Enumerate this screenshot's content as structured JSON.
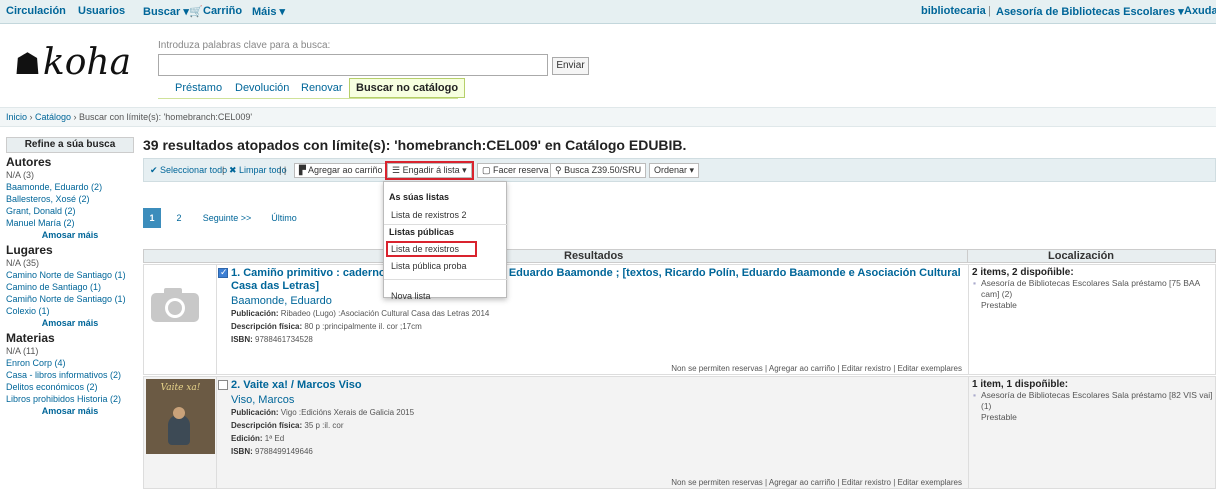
{
  "nav": {
    "circulacion": "Circulación",
    "usuarios": "Usuarios",
    "buscar": "Buscar ▾",
    "carrinho": "Carriño",
    "mais": "Máis ▾",
    "user": "bibliotecaria",
    "library": "Asesoría de Bibliotecas Escolares ▾",
    "axuda": "Axuda"
  },
  "logo": "koha",
  "search": {
    "hint": "Introduza palabras clave para a busca:",
    "value": "",
    "submit": "Enviar",
    "tabs": [
      "Préstamo",
      "Devolución",
      "Renovar",
      "Buscar no catálogo"
    ]
  },
  "breadcrumb": {
    "inicio": "Inicio",
    "catalogo": "Catálogo",
    "buscar": "Buscar",
    "rest": "con límite(s): 'homebranch:CEL009'"
  },
  "sidebar": {
    "refine": "Refine a súa busca",
    "autores": {
      "title": "Autores",
      "items": [
        "N/A (3)",
        "Baamonde, Eduardo (2)",
        "Ballesteros, Xosé (2)",
        "Grant, Donald (2)",
        "Manuel María (2)"
      ],
      "more": "Amosar máis"
    },
    "lugares": {
      "title": "Lugares",
      "items": [
        "N/A (35)",
        "Camino Norte de Santiago (1)",
        "Camino de Santiago (1)",
        "Camiño Norte de Santiago (1)",
        "Colexio (1)"
      ],
      "more": "Amosar máis"
    },
    "materias": {
      "title": "Materias",
      "items": [
        "N/A (11)",
        "Enron Corp (4)",
        "Casa - libros informativos (2)",
        "Delitos económicos (2)",
        "Libros prohibidos Historia (2)"
      ],
      "more": "Amosar máis"
    }
  },
  "results": {
    "heading": "39 resultados atopados  con límite(s): 'homebranch:CEL009' en Catálogo EDUBIB.",
    "toolbar": {
      "select_all": "✔ Seleccionar todo",
      "clear_all": "✖ Limpar todo",
      "add_cart": "Agregar ao carriño",
      "add_list": "Engadir á lista ▾",
      "reserve": "Facer reserva",
      "z3950": "Busca Z39.50/SRU",
      "sort": "Ordenar ▾"
    },
    "pages": [
      "1",
      "2",
      "Seguinte >>",
      "Último"
    ],
    "col_results": "Resultados",
    "col_location": "Localización",
    "rows": [
      {
        "title": "1. Camiño primitivo : caderno de viaxe =sketchbook/ Eduardo Baamonde ; [textos, Ricardo Polín, Eduardo Baamonde e Asociación Cultural Casa das Letras]",
        "author": "Baamonde, Eduardo",
        "pub_label": "Publicación:",
        "pub": "Ribadeo (Lugo) :Asociación Cultural Casa das Letras 2014",
        "desc_label": "Descripción física:",
        "desc": "80 p :principalmente il. cor ;17cm",
        "isbn_label": "ISBN:",
        "isbn": "9788461734528",
        "actions": "Non se permiten reservas | Agregar ao carriño | Editar rexistro | Editar exemplares",
        "avail": "2 items, 2 dispoñible:",
        "loc": "Asesoría de Bibliotecas Escolares Sala préstamo [75 BAA cam] (2)",
        "status": "Prestable"
      },
      {
        "title": "2. Vaite xa! / Marcos Viso",
        "author": "Viso, Marcos",
        "pub_label": "Publicación:",
        "pub": "Vigo :Edicións Xerais de Galicia 2015",
        "desc_label": "Descripción física:",
        "desc": "35 p :il. cor",
        "ed_label": "Edición:",
        "ed": "1ª Ed",
        "isbn_label": "ISBN:",
        "isbn": "9788499149646",
        "actions": "Non se permiten reservas | Agregar ao carriño | Editar rexistro | Editar exemplares",
        "avail": "1 item, 1 dispoñible:",
        "loc": "Asesoría de Bibliotecas Escolares Sala préstamo [82 VIS vai] (1)",
        "status": "Prestable",
        "cover_text": "Vaite xa!"
      }
    ]
  },
  "dropdown": {
    "own_head": "As súas listas",
    "own_item": "Lista de rexistros 2",
    "public_head": "Listas públicas",
    "public_items": [
      "Lista de rexistros",
      "Lista pública proba"
    ],
    "new_list": "Nova lista"
  }
}
